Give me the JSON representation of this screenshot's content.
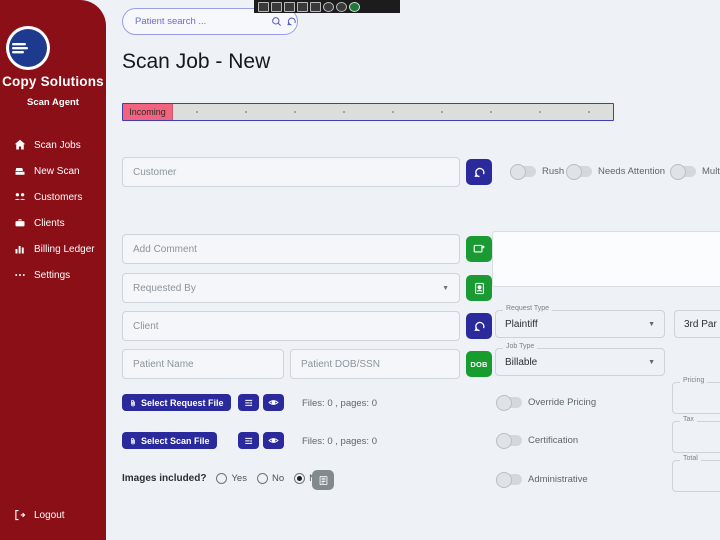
{
  "app": {
    "brand_title": "Copy Solutions",
    "brand_subtitle": "Scan Agent"
  },
  "sidebar": {
    "items": [
      {
        "label": "Scan Jobs",
        "icon": "home-icon"
      },
      {
        "label": "New Scan",
        "icon": "scanner-icon"
      },
      {
        "label": "Customers",
        "icon": "users-icon"
      },
      {
        "label": "Clients",
        "icon": "briefcase-icon"
      },
      {
        "label": "Billing Ledger",
        "icon": "chart-icon"
      },
      {
        "label": "Settings",
        "icon": "ellipsis-icon"
      }
    ],
    "logout_label": "Logout"
  },
  "search": {
    "value": "",
    "placeholder": "Patient search ..."
  },
  "header": {
    "page_title": "Scan Job - New"
  },
  "toolbar": {
    "icons": [
      "screenshot-icon",
      "window-icon",
      "flag-icon",
      "frame-icon",
      "arrow-icon",
      "clock-icon",
      "user-icon",
      "check-icon"
    ]
  },
  "stepper": {
    "active_label": "Incoming",
    "steps_remaining": 9
  },
  "form": {
    "customer_placeholder": "Customer",
    "customer_value": "",
    "comment_placeholder": "Add Comment",
    "comment_value": "",
    "requested_by_placeholder": "Requested By",
    "requested_by_value": "",
    "client_placeholder": "Client",
    "client_value": "",
    "patient_name_placeholder": "Patient Name",
    "patient_name_value": "",
    "patient_dob_placeholder": "Patient DOB/SSN",
    "patient_dob_value": "",
    "dob_button_label": "DOB"
  },
  "toggles": {
    "rush": "Rush",
    "needs_attention": "Needs Attention",
    "multiple": "Multip",
    "override_pricing": "Override Pricing",
    "certification": "Certification",
    "administrative": "Administrative"
  },
  "selects": {
    "request_type_legend": "Request Type",
    "request_type_value": "Plaintiff",
    "third_party_value": "3rd Par",
    "job_type_legend": "Job Type",
    "job_type_value": "Billable"
  },
  "totals": {
    "pricing_legend": "Pricing",
    "pricing_value": "",
    "tax_legend": "Tax",
    "tax_value": "",
    "total_legend": "Total",
    "total_value": ""
  },
  "files": {
    "request_button": "Select Request File",
    "scan_button": "Select Scan File",
    "request_count": "Files:  0 , pages:  0",
    "scan_count": "Files:  0 , pages:  0"
  },
  "images": {
    "question": "Images included?",
    "yes": "Yes",
    "no": "No",
    "na": "N/A",
    "selected": "N/A"
  },
  "colors": {
    "sidebar": "#8b0f16",
    "accent_indigo": "#2a2a9c",
    "accent_green": "#1a9a33",
    "step_active": "#f4637d",
    "search_border": "#9b9ce8"
  }
}
